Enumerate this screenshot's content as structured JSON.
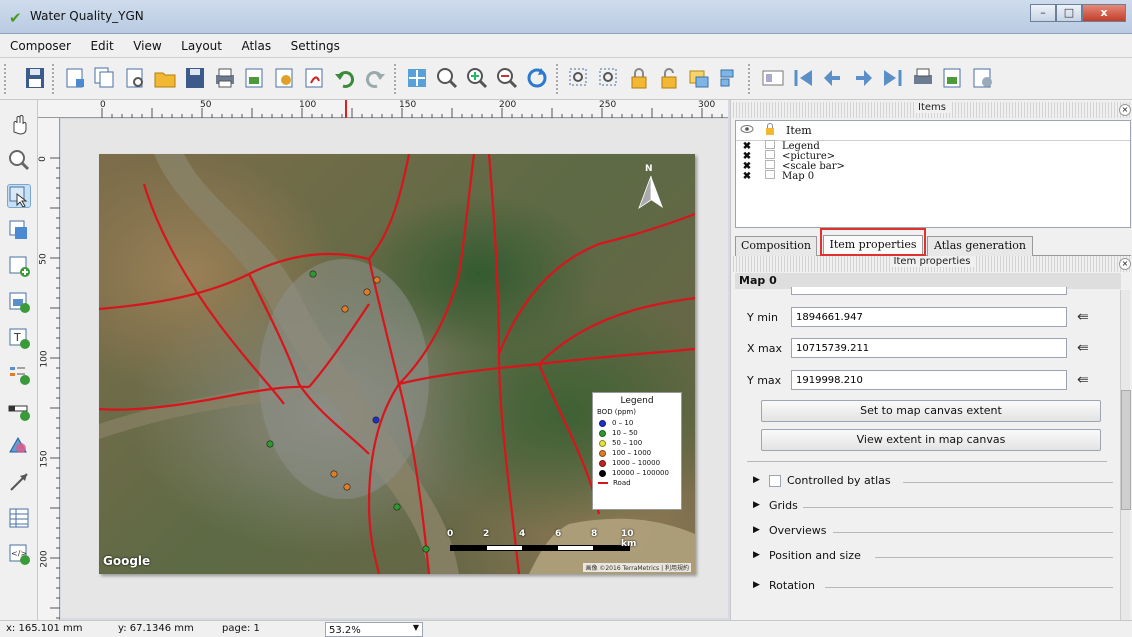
{
  "window": {
    "title": "Water Quality_YGN",
    "minimize": "–",
    "maximize": "□",
    "close": "x"
  },
  "menu": [
    "Composer",
    "Edit",
    "View",
    "Layout",
    "Atlas",
    "Settings"
  ],
  "ruler": {
    "h_labels": [
      "0",
      "50",
      "100",
      "150",
      "200",
      "250",
      "300"
    ],
    "v_labels": [
      "0",
      "50",
      "100",
      "150",
      "200"
    ]
  },
  "map": {
    "google_logo": "Google",
    "attribution": "画像 ©2016 TerraMetrics | 利用規約",
    "north": "N",
    "points": [
      {
        "color": "#2d9a2d"
      },
      {
        "color": "#e07b26"
      },
      {
        "color": "#e07b26"
      },
      {
        "color": "#e07b26"
      },
      {
        "color": "#1f2fcc"
      },
      {
        "color": "#2d9a2d"
      },
      {
        "color": "#e07b26"
      },
      {
        "color": "#e07b26"
      },
      {
        "color": "#2d9a2d"
      },
      {
        "color": "#2d9a2d"
      }
    ]
  },
  "legend": {
    "title": "Legend",
    "subtitle": "BOD (ppm)",
    "entries": [
      {
        "label": "0 – 10",
        "color": "#1f2fcc"
      },
      {
        "label": "10 – 50",
        "color": "#2d9a2d"
      },
      {
        "label": "50 – 100",
        "color": "#e8e23a"
      },
      {
        "label": "100 – 1000",
        "color": "#e07b26"
      },
      {
        "label": "1000 – 10000",
        "color": "#c0251d"
      },
      {
        "label": "10000 – 100000",
        "color": "#000000"
      }
    ],
    "road_label": "Road",
    "road_color": "#d8141c"
  },
  "scalebar": {
    "labels": [
      "0",
      "2",
      "4",
      "6",
      "8",
      "10 km"
    ]
  },
  "items_panel": {
    "header": "Items",
    "column_item": "Item",
    "rows": [
      "Legend",
      "<picture>",
      "<scale bar>",
      "Map 0"
    ]
  },
  "tabs": [
    "Composition",
    "Item properties",
    "Atlas generation"
  ],
  "item_properties": {
    "header": "Item properties",
    "section": "Map 0",
    "fields": [
      {
        "label": "Y min",
        "value": "1894661.947"
      },
      {
        "label": "X max",
        "value": "10715739.211"
      },
      {
        "label": "Y max",
        "value": "1919998.210"
      }
    ],
    "buttons": [
      "Set to map canvas extent",
      "View extent in map canvas"
    ],
    "controlled_by_atlas": "Controlled by atlas",
    "groups": [
      "Grids",
      "Overviews",
      "Position and size",
      "Rotation"
    ]
  },
  "status": {
    "x": "x: 165.101 mm",
    "y": "y: 67.1346 mm",
    "page": "page: 1",
    "zoom": "53.2%"
  }
}
